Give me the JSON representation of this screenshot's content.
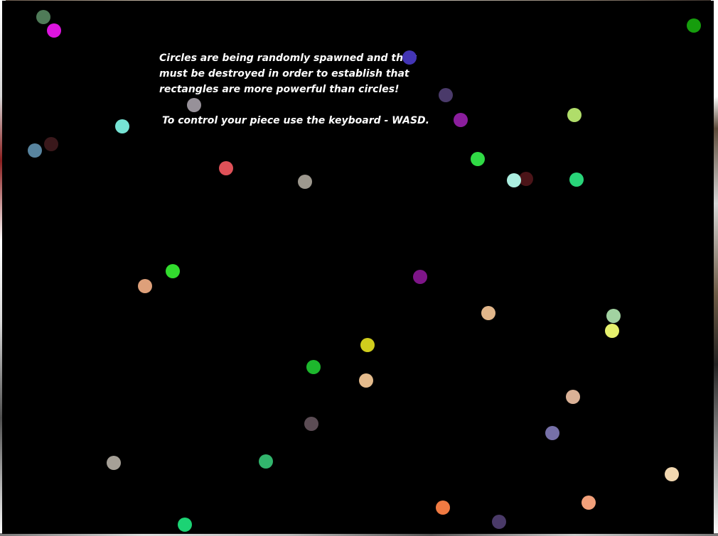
{
  "instructions": {
    "line1": "Circles are being randomly spawned and they",
    "line2": "must be destroyed in order to establish that",
    "line3": "rectangles are more powerful than circles!",
    "line4": "To control your piece use the keyboard - WASD."
  },
  "colors": {
    "canvas": "#000000",
    "text": "#ffffff"
  },
  "circles": [
    {
      "color": "#4f7b58"
    },
    {
      "color": "#dd14df"
    },
    {
      "color": "#169d0d"
    },
    {
      "color": "#4335b5"
    },
    {
      "color": "#4a3a6a"
    },
    {
      "color": "#979199"
    },
    {
      "color": "#8b1e9d"
    },
    {
      "color": "#b0dd6a"
    },
    {
      "color": "#76e3d4"
    },
    {
      "color": "#58849f"
    },
    {
      "color": "#3a181b"
    },
    {
      "color": "#df5158"
    },
    {
      "color": "#9d988e"
    },
    {
      "color": "#30da45"
    },
    {
      "color": "#4b1418"
    },
    {
      "color": "#abeee0"
    },
    {
      "color": "#29d479"
    },
    {
      "color": "#32dc2e"
    },
    {
      "color": "#dea07a"
    },
    {
      "color": "#7e1588"
    },
    {
      "color": "#e1b68a"
    },
    {
      "color": "#a2d2a1"
    },
    {
      "color": "#e6f16d"
    },
    {
      "color": "#d0cd1d"
    },
    {
      "color": "#1db72d"
    },
    {
      "color": "#e4bb8c"
    },
    {
      "color": "#dab196"
    },
    {
      "color": "#5b4c54"
    },
    {
      "color": "#7670a8"
    },
    {
      "color": "#a6a097"
    },
    {
      "color": "#32b56d"
    },
    {
      "color": "#f2d8b1"
    },
    {
      "color": "#f07a42"
    },
    {
      "color": "#f2a07a"
    },
    {
      "color": "#4a3a68"
    },
    {
      "color": "#1cd374"
    }
  ]
}
